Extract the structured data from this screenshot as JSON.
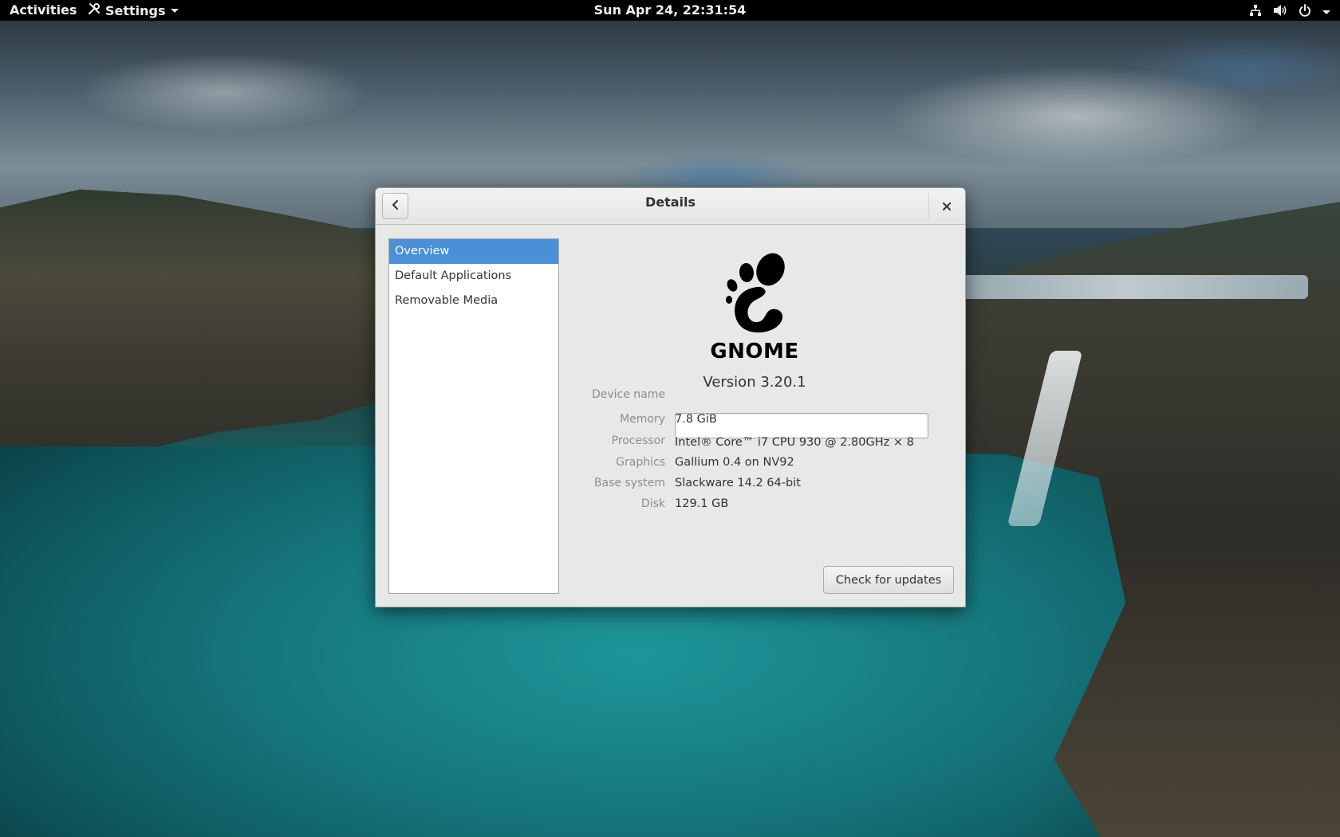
{
  "topbar": {
    "activities": "Activities",
    "app_menu": "Settings",
    "clock": "Sun Apr 24, 22:31:54",
    "status_icons": [
      "network-icon",
      "volume-icon",
      "power-icon"
    ]
  },
  "dialog": {
    "title": "Details",
    "back_icon": "chevron-left-icon",
    "close_icon": "close-icon"
  },
  "sidebar": {
    "items": [
      {
        "label": "Overview",
        "selected": true
      },
      {
        "label": "Default Applications",
        "selected": false
      },
      {
        "label": "Removable Media",
        "selected": false
      }
    ]
  },
  "overview": {
    "logo_text": "GNOME",
    "version": "Version 3.20.1",
    "fields": {
      "device_name": {
        "label": "Device name",
        "value": ""
      },
      "memory": {
        "label": "Memory",
        "value": "7.8 GiB"
      },
      "processor": {
        "label": "Processor",
        "value": "Intel® Core™ i7 CPU 930 @ 2.80GHz × 8"
      },
      "graphics": {
        "label": "Graphics",
        "value": "Gallium 0.4 on NV92"
      },
      "base_system": {
        "label": "Base system",
        "value": "Slackware 14.2 64-bit"
      },
      "disk": {
        "label": "Disk",
        "value": "129.1 GB"
      }
    },
    "check_updates_label": "Check for updates"
  },
  "colors": {
    "selection": "#4a90d9",
    "topbar": "#000000",
    "dialog_bg": "#e8e8e7"
  }
}
